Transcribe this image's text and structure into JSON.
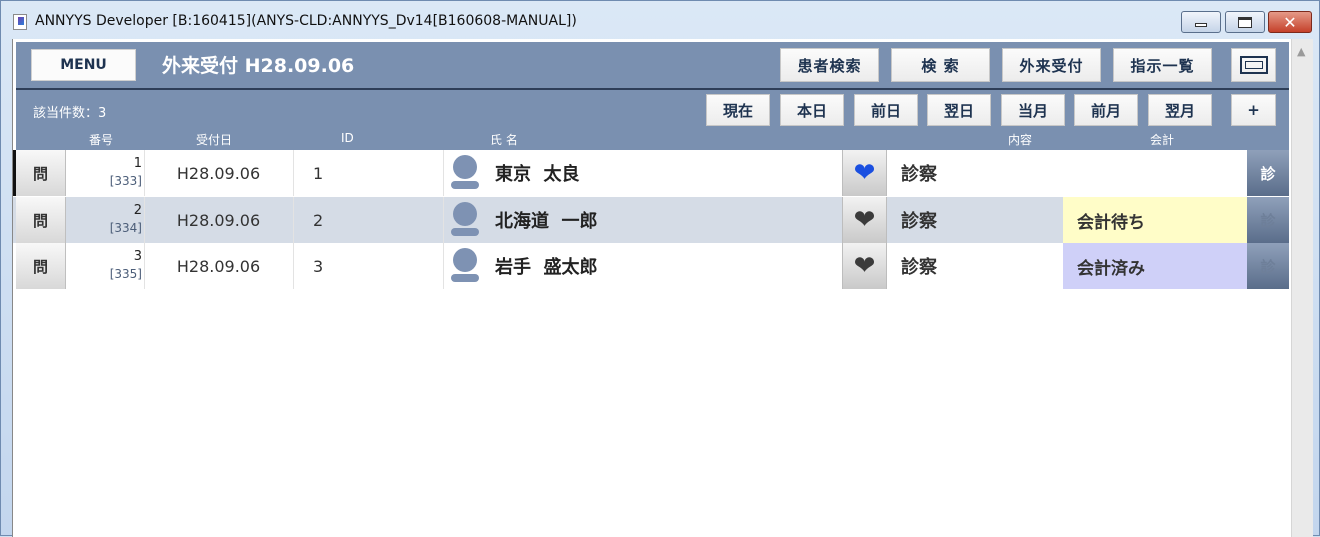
{
  "window": {
    "title": "ANNYYS Developer [B:160415](ANYS-CLD:ANNYYS_Dv14[B160608-MANUAL])",
    "close_label": "✕"
  },
  "toolbar": {
    "menu_label": "MENU",
    "screen_title": "外来受付  H28.09.06",
    "buttons": [
      "患者検索",
      "検 索",
      "外来受付",
      "指示一覧"
    ]
  },
  "subbar": {
    "count_label": "該当件数：3",
    "date_buttons": [
      "現在",
      "本日",
      "前日",
      "翌日",
      "当月",
      "前月",
      "翌月",
      "+"
    ]
  },
  "columns": {
    "number": "番号",
    "date": "受付日",
    "id": "ID",
    "name": "氏 名",
    "content": "内容",
    "accounting": "会計"
  },
  "rows": [
    {
      "q_label": "問",
      "number": "1",
      "sub_number": "[333]",
      "date": "H28.09.06",
      "id": "1",
      "name": "東京  太良",
      "heart_color": "#1a4fe0",
      "content": "診察",
      "accounting": "",
      "accounting_bg": "#ffffff",
      "shin_label": "診",
      "shin_color": "#ffffff"
    },
    {
      "q_label": "問",
      "number": "2",
      "sub_number": "[334]",
      "date": "H28.09.06",
      "id": "2",
      "name": "北海道  一郎",
      "heart_color": "#3b3b3b",
      "content": "診察",
      "accounting": "会計待ち",
      "accounting_bg": "#fffdc8",
      "shin_label": "診",
      "shin_color": "#6e7f99"
    },
    {
      "q_label": "問",
      "number": "3",
      "sub_number": "[335]",
      "date": "H28.09.06",
      "id": "3",
      "name": "岩手  盛太郎",
      "heart_color": "#3b3b3b",
      "content": "診察",
      "accounting": "会計済み",
      "accounting_bg": "#cfd0f8",
      "shin_label": "診",
      "shin_color": "#6e7f99"
    }
  ]
}
